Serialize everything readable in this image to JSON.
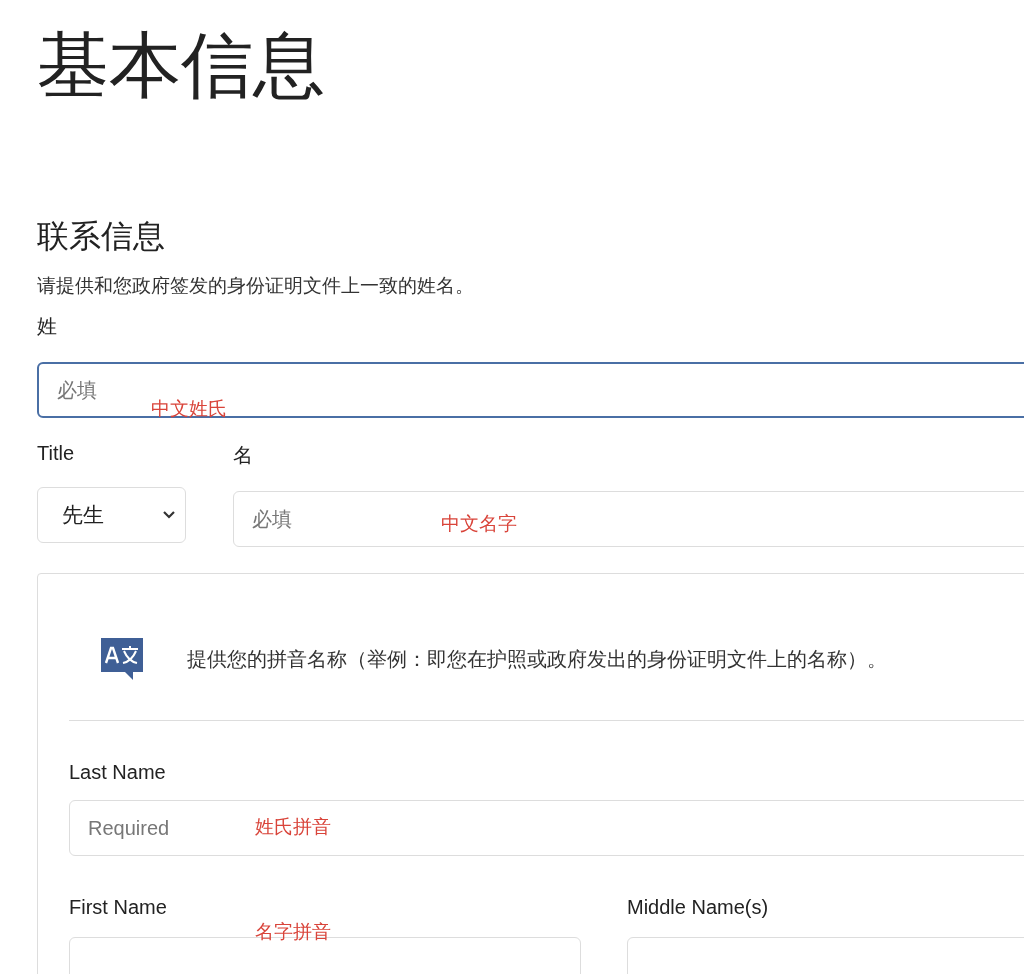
{
  "page_title": "基本信息",
  "section": {
    "title": "联系信息",
    "description": "请提供和您政府签发的身份证明文件上一致的姓名。"
  },
  "surname": {
    "label": "姓",
    "placeholder": "必填",
    "focused": true,
    "annotation": "中文姓氏"
  },
  "title_field": {
    "label": "Title",
    "value": "先生"
  },
  "given_name": {
    "label": "名",
    "placeholder": "必填",
    "annotation": "中文名字"
  },
  "pinyin_card": {
    "notice": "提供您的拼音名称（举例：即您在护照或政府发出的身份证明文件上的名称）。",
    "last_name": {
      "label": "Last Name",
      "placeholder": "Required",
      "annotation": "姓氏拼音"
    },
    "first_name": {
      "label": "First Name",
      "annotation": "名字拼音"
    },
    "middle_name": {
      "label": "Middle Name(s)"
    }
  }
}
